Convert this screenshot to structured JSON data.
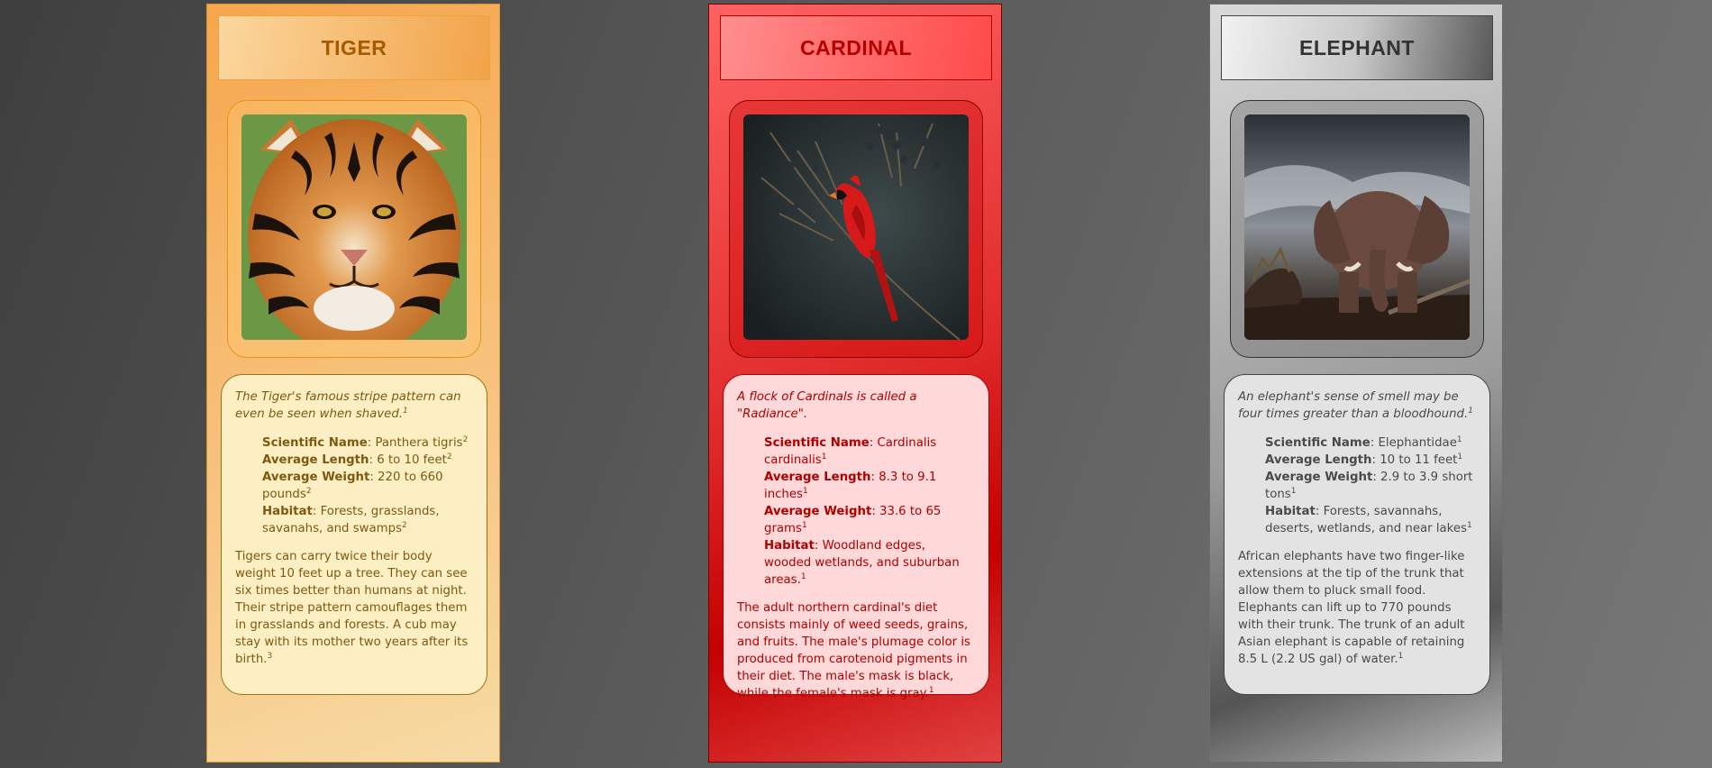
{
  "cards": [
    {
      "title": "TIGER",
      "image_alt": "Tiger face photo",
      "fact": "The Tiger's famous stripe pattern can even be seen when shaved.",
      "fact_ref": "1",
      "stats": [
        {
          "label": "Scientific Name",
          "value": "Panthera tigris",
          "ref": "2"
        },
        {
          "label": "Average Length",
          "value": "6 to 10 feet",
          "ref": "2"
        },
        {
          "label": "Average Weight",
          "value": "220 to 660 pounds",
          "ref": "2"
        },
        {
          "label": "Habitat",
          "value": "Forests, grasslands, savanahs, and swamps",
          "ref": "2"
        }
      ],
      "description": "Tigers can carry twice their body weight 10 feet up a tree. They can see six times better than humans at night. Their stripe pattern camouflages them in grasslands and forests. A cub may stay with its mother two years after its birth.",
      "description_ref": "3",
      "colors": {
        "accent": "#f2a349",
        "text": "#7d5a0f",
        "title": "#a65a00"
      }
    },
    {
      "title": "CARDINAL",
      "image_alt": "Red cardinal perched on branch photo",
      "fact": "A flock of Cardinals is called a \"Radiance\".",
      "fact_ref": "",
      "stats": [
        {
          "label": "Scientific Name",
          "value": "Cardinalis cardinalis",
          "ref": "1"
        },
        {
          "label": "Average Length",
          "value": "8.3 to 9.1 inches",
          "ref": "1"
        },
        {
          "label": "Average Weight",
          "value": "33.6 to 65 grams",
          "ref": "1"
        },
        {
          "label": "Habitat",
          "value": "Woodland edges, wooded wetlands, and suburban areas.",
          "ref": "1"
        }
      ],
      "description": "The adult northern cardinal's diet consists mainly of weed seeds, grains, and fruits. The male's plumage color is produced from carotenoid pigments in their diet. The male's mask is black, while the female's mask is gray.",
      "description_ref": "1",
      "colors": {
        "accent": "#ff4a4a",
        "text": "#b00000",
        "title": "#b60000"
      }
    },
    {
      "title": "ELEPHANT",
      "image_alt": "Elephant under dramatic sky photo",
      "fact": "An elephant's sense of smell may be four times greater than a bloodhound.",
      "fact_ref": "1",
      "stats": [
        {
          "label": "Scientific Name",
          "value": "Elephantidae",
          "ref": "1"
        },
        {
          "label": "Average Length",
          "value": "10 to 11 feet",
          "ref": "1"
        },
        {
          "label": "Average Weight",
          "value": "2.9 to 3.9 short tons",
          "ref": "1"
        },
        {
          "label": "Habitat",
          "value": "Forests, savannahs, deserts, wetlands, and near lakes",
          "ref": "1"
        }
      ],
      "description": "African elephants have two finger-like extensions at the tip of the trunk that allow them to pluck small food. Elephants can lift up to 770 pounds with their trunk. The trunk of an adult Asian elephant is capable of retaining 8.5 L (2.2 US gal) of water.",
      "description_ref": "1",
      "colors": {
        "accent": "#9a9a9a",
        "text": "#4a4a4a",
        "title": "#333333"
      }
    }
  ]
}
